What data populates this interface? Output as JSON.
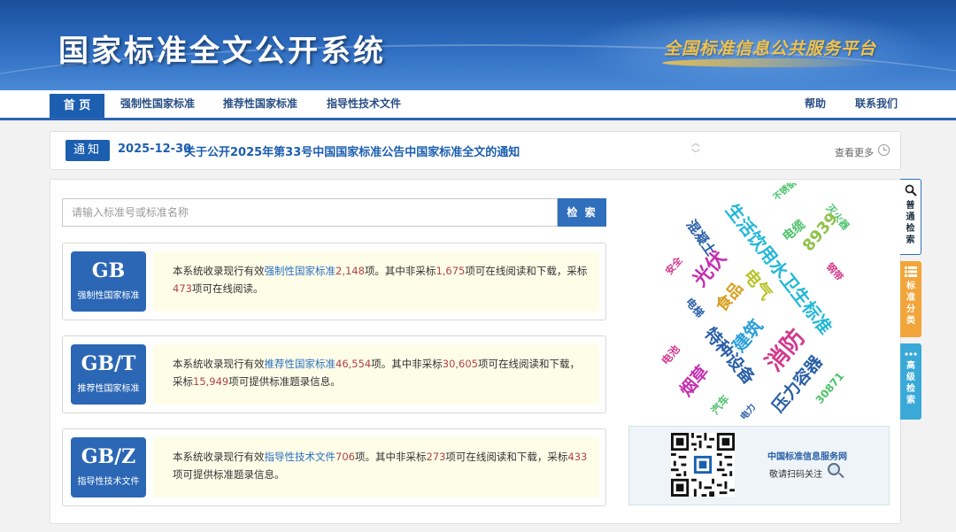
{
  "header": {
    "title": "国家标准全文公开系统",
    "slogan": "全国标准信息公共服务平台"
  },
  "nav": {
    "items": [
      {
        "label": "首 页",
        "active": true
      },
      {
        "label": "强制性国家标准"
      },
      {
        "label": "推荐性国家标准"
      },
      {
        "label": "指导性技术文件"
      }
    ],
    "right_items": [
      {
        "label": "帮助"
      },
      {
        "label": "联系我们"
      }
    ]
  },
  "notice": {
    "tag": "通知",
    "date": "2025-12-30",
    "text": "关于公开2025年第33号中国国家标准公告中国家标准全文的通知",
    "more": "查看更多"
  },
  "search": {
    "placeholder": "请输入标准号或标准名称",
    "button": "检 索"
  },
  "standards": [
    {
      "code": "GB",
      "label": "强制性国家标准",
      "d1": "本系统收录现行有效",
      "type": "强制性国家标准",
      "total": "2,148",
      "d2": "项。其中非采标",
      "read": "1,675",
      "d3": "项可在线阅读和下载，采标",
      "adopt": "473",
      "d4": "项可在线阅读。"
    },
    {
      "code": "GB/T",
      "label": "推荐性国家标准",
      "d1": "本系统收录现行有效",
      "type": "推荐性国家标准",
      "total": "46,554",
      "d2": "项。其中非采标",
      "read": "30,605",
      "d3": "项可在线阅读和下载，采标",
      "adopt": "15,949",
      "d4": "项可提供标准题录信息。"
    },
    {
      "code": "GB/Z",
      "label": "指导性技术文件",
      "d1": "本系统收录现行有效",
      "type": "指导性技术文件",
      "total": "706",
      "d2": "项。其中非采标",
      "read": "273",
      "d3": "项可在线阅读和下载，采标",
      "adopt": "433",
      "d4": "项可提供标准题录信息。"
    }
  ],
  "word_cloud": [
    {
      "text": "混凝土",
      "color": "#2a5fa8"
    },
    {
      "text": "生活饮用水卫生标准",
      "color": "#22b8d8"
    },
    {
      "text": "不锈钢",
      "color": "#4cc26a"
    },
    {
      "text": "电缆",
      "color": "#4cc26a"
    },
    {
      "text": "灭火器",
      "color": "#4cc26a"
    },
    {
      "text": "8939",
      "color": "#8fc24a"
    },
    {
      "text": "钢带",
      "color": "#d23a8e"
    },
    {
      "text": "安全",
      "color": "#d23a8e"
    },
    {
      "text": "光伏",
      "color": "#c42fb0"
    },
    {
      "text": "电气",
      "color": "#b7c42a"
    },
    {
      "text": "食品",
      "color": "#d6a020"
    },
    {
      "text": "电梯",
      "color": "#2a5fa8"
    },
    {
      "text": "建筑",
      "color": "#2a9fd8"
    },
    {
      "text": "消防",
      "color": "#d23a8e"
    },
    {
      "text": "特种设备",
      "color": "#2a5fa8"
    },
    {
      "text": "电池",
      "color": "#d23a8e"
    },
    {
      "text": "烟草",
      "color": "#c42fb0"
    },
    {
      "text": "压力容器",
      "color": "#2a5fa8"
    },
    {
      "text": "汽车",
      "color": "#4cc26a"
    },
    {
      "text": "电力",
      "color": "#2a5fa8"
    },
    {
      "text": "30871",
      "color": "#4cc26a"
    }
  ],
  "qr": {
    "title": "中国标准信息服务网",
    "subtitle": "敬请扫码关注"
  },
  "side_tabs": [
    {
      "label": "普通检索"
    },
    {
      "label": "标准分类"
    },
    {
      "label": "高级检索"
    }
  ]
}
